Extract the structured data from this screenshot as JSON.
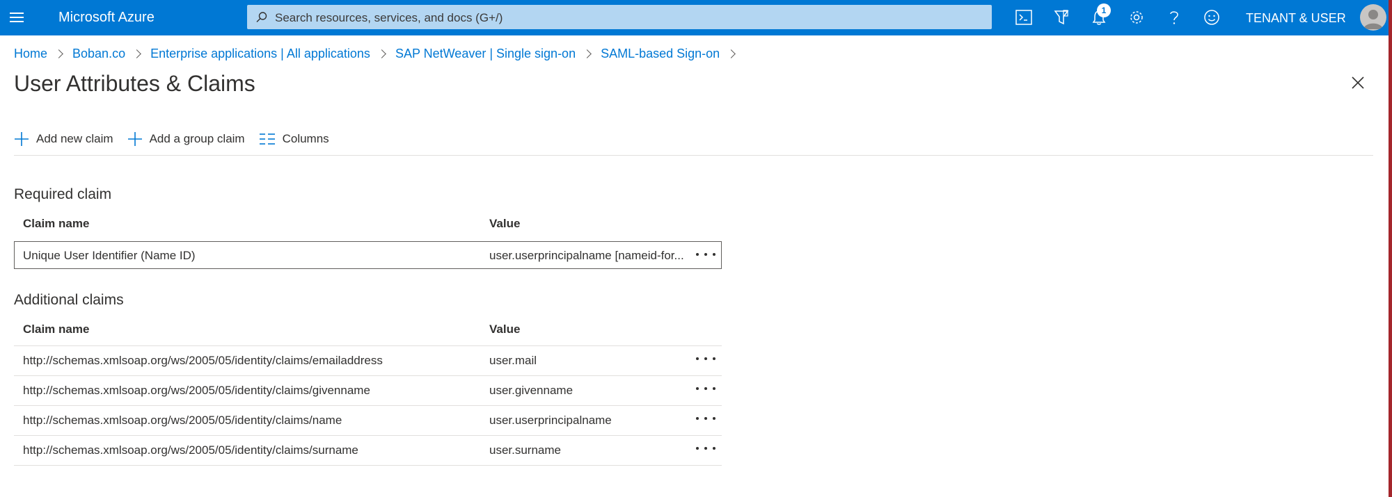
{
  "header": {
    "brand": "Microsoft Azure",
    "search_placeholder": "Search resources, services, and docs (G+/)",
    "notification_count": "1",
    "account": "TENANT & USER",
    "icons": [
      "menu-icon",
      "search-icon",
      "cloud-shell-icon",
      "directory-filter-icon",
      "notifications-icon",
      "settings-icon",
      "help-icon",
      "feedback-icon",
      "avatar-icon"
    ]
  },
  "breadcrumb": [
    "Home",
    "Boban.co",
    "Enterprise applications | All applications",
    "SAP NetWeaver | Single sign-on",
    "SAML-based Sign-on"
  ],
  "page": {
    "title": "User Attributes & Claims"
  },
  "toolbar": {
    "add_new_claim": "Add new claim",
    "add_group_claim": "Add a group claim",
    "columns": "Columns"
  },
  "required": {
    "title": "Required claim",
    "col_name": "Claim name",
    "col_value": "Value",
    "rows": [
      {
        "name": "Unique User Identifier (Name ID)",
        "value": "user.userprincipalname [nameid-for..."
      }
    ]
  },
  "additional": {
    "title": "Additional claims",
    "col_name": "Claim name",
    "col_value": "Value",
    "rows": [
      {
        "name": "http://schemas.xmlsoap.org/ws/2005/05/identity/claims/emailaddress",
        "value": "user.mail"
      },
      {
        "name": "http://schemas.xmlsoap.org/ws/2005/05/identity/claims/givenname",
        "value": "user.givenname"
      },
      {
        "name": "http://schemas.xmlsoap.org/ws/2005/05/identity/claims/name",
        "value": "user.userprincipalname"
      },
      {
        "name": "http://schemas.xmlsoap.org/ws/2005/05/identity/claims/surname",
        "value": "user.surname"
      }
    ]
  },
  "colors": {
    "brand_blue": "#0078d4",
    "search_bg": "#b3d6f2",
    "text": "#323130",
    "divider": "#e1dfdd"
  }
}
